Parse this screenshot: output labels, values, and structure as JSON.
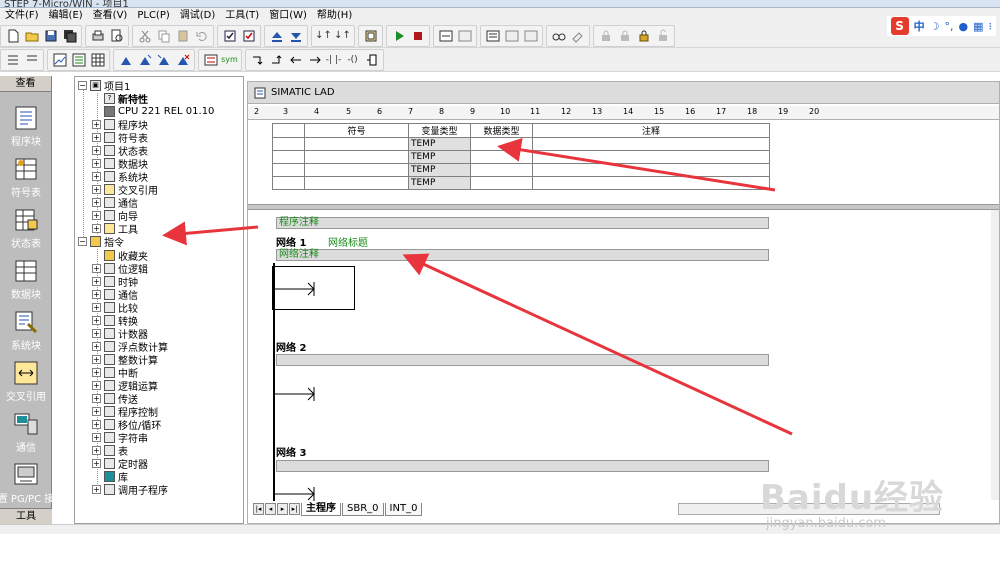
{
  "window": {
    "title": "STEP 7-Micro/WIN - 项目1"
  },
  "menu": [
    "文件(F)",
    "编辑(E)",
    "查看(V)",
    "PLC(P)",
    "调试(D)",
    "工具(T)",
    "窗口(W)",
    "帮助(H)"
  ],
  "ime": {
    "logo": "S",
    "mode": "中"
  },
  "nav": {
    "header": "查看",
    "footer": "工具",
    "items": [
      {
        "label": "程序块",
        "icon": "program-block-icon"
      },
      {
        "label": "符号表",
        "icon": "symbol-table-icon"
      },
      {
        "label": "状态表",
        "icon": "status-table-icon"
      },
      {
        "label": "数据块",
        "icon": "data-block-icon"
      },
      {
        "label": "系统块",
        "icon": "system-block-icon"
      },
      {
        "label": "交叉引用",
        "icon": "cross-reference-icon"
      },
      {
        "label": "通信",
        "icon": "communication-icon"
      },
      {
        "label": "设置 PG/PC 接口",
        "icon": "pgpc-interface-icon"
      }
    ]
  },
  "tree": {
    "project": {
      "label": "项目1",
      "children": [
        "新特性",
        "CPU 221 REL 01.10",
        "程序块",
        "符号表",
        "状态表",
        "数据块",
        "系统块",
        "交叉引用",
        "通信",
        "向导",
        "工具"
      ]
    },
    "instructions": {
      "label": "指令",
      "children": [
        "收藏夹",
        "位逻辑",
        "时钟",
        "通信",
        "比较",
        "转换",
        "计数器",
        "浮点数计算",
        "整数计算",
        "中断",
        "逻辑运算",
        "传送",
        "程序控制",
        "移位/循环",
        "字符串",
        "表",
        "定时器",
        "库",
        "调用子程序"
      ]
    }
  },
  "editor": {
    "title": "SIMATIC LAD",
    "ruler": [
      "2",
      "3",
      "4",
      "5",
      "6",
      "7",
      "8",
      "9",
      "10",
      "11",
      "12",
      "13",
      "14",
      "15",
      "16",
      "17",
      "18",
      "19",
      "20"
    ],
    "var_table": {
      "headers": [
        "符号",
        "变量类型",
        "数据类型",
        "注释"
      ],
      "rows": [
        {
          "symbol": "",
          "vartype": "TEMP",
          "datatype": "",
          "comment": ""
        },
        {
          "symbol": "",
          "vartype": "TEMP",
          "datatype": "",
          "comment": ""
        },
        {
          "symbol": "",
          "vartype": "TEMP",
          "datatype": "",
          "comment": ""
        },
        {
          "symbol": "",
          "vartype": "TEMP",
          "datatype": "",
          "comment": ""
        }
      ]
    },
    "program_comment": "程序注释",
    "networks": [
      {
        "label": "网络 1",
        "title": "网络标题",
        "comment": "网络注释"
      },
      {
        "label": "网络 2",
        "title": "",
        "comment": ""
      },
      {
        "label": "网络 3",
        "title": "",
        "comment": ""
      }
    ],
    "tabs": [
      "主程序",
      "SBR_0",
      "INT_0"
    ]
  },
  "watermark": {
    "brand": "Baidu经验",
    "url": "jingyan.baidu.com"
  },
  "colors": {
    "annotation_arrow": "#e8343c",
    "comment_text": "#1a8a1a",
    "nav_bg": "#bdbdbd"
  }
}
